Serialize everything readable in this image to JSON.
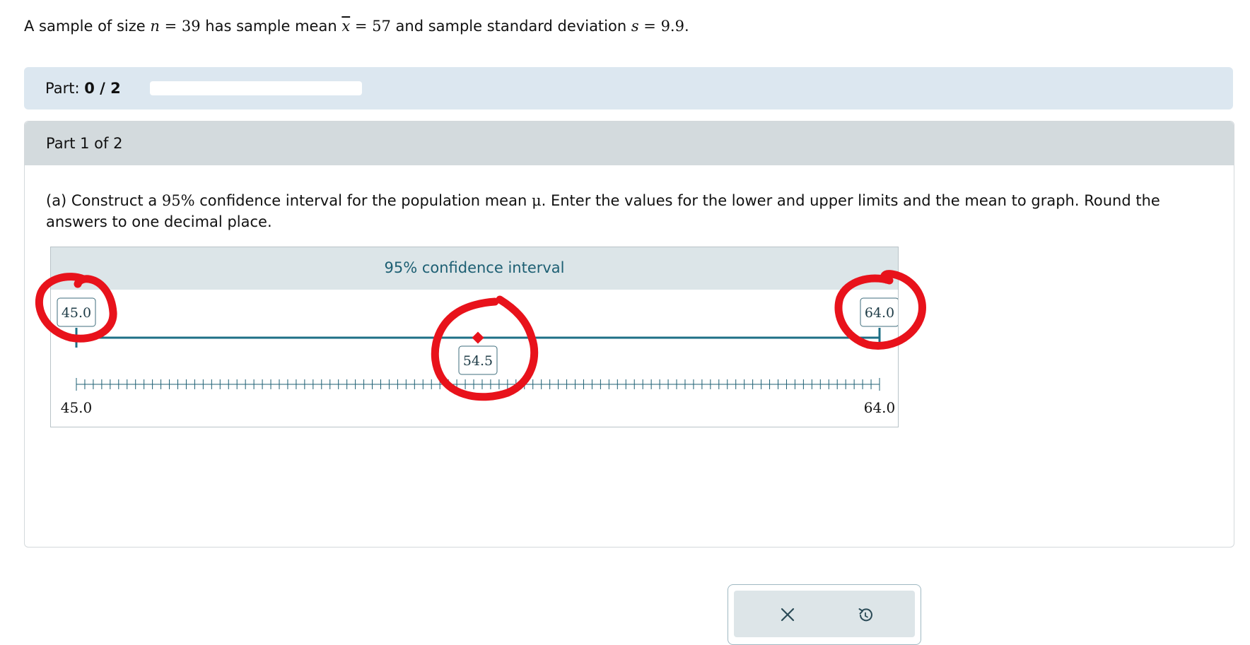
{
  "problem": {
    "prefix": "A sample of size ",
    "n_var": "n",
    "eq1": " = 39",
    "mid1": " has sample mean ",
    "mean_var": "x",
    "eq2": " = 57",
    "mid2": " and sample standard deviation ",
    "s_var": "s",
    "eq3": " = 9.9",
    "end": "."
  },
  "progress": {
    "label": "Part: ",
    "value": "0 / 2",
    "fraction": 0
  },
  "part": {
    "title": "Part 1 of 2",
    "question": {
      "prefix": "(a) Construct a ",
      "percent": "95%",
      "mid": " confidence interval for the population mean ",
      "mu": "μ",
      "end": ". Enter the values for the lower and upper limits and the mean to graph. Round the answers to one decimal place."
    }
  },
  "graph": {
    "title": "95% confidence interval",
    "axis_min": 45.0,
    "axis_max": 64.0,
    "axis_min_label": "45.0",
    "axis_max_label": "64.0",
    "tick_step": 0.2,
    "lower": 45.0,
    "lower_label": "45.0",
    "upper": 64.0,
    "upper_label": "64.0",
    "mean": 54.5,
    "mean_label": "54.5",
    "colors": {
      "interval": "#1d6f86",
      "mean_marker": "#e8121b",
      "ticks": "#1d5f73"
    }
  },
  "actions": {
    "clear_icon": "close-icon",
    "undo_icon": "undo-icon"
  },
  "annotation": {
    "color": "#e8121b"
  }
}
